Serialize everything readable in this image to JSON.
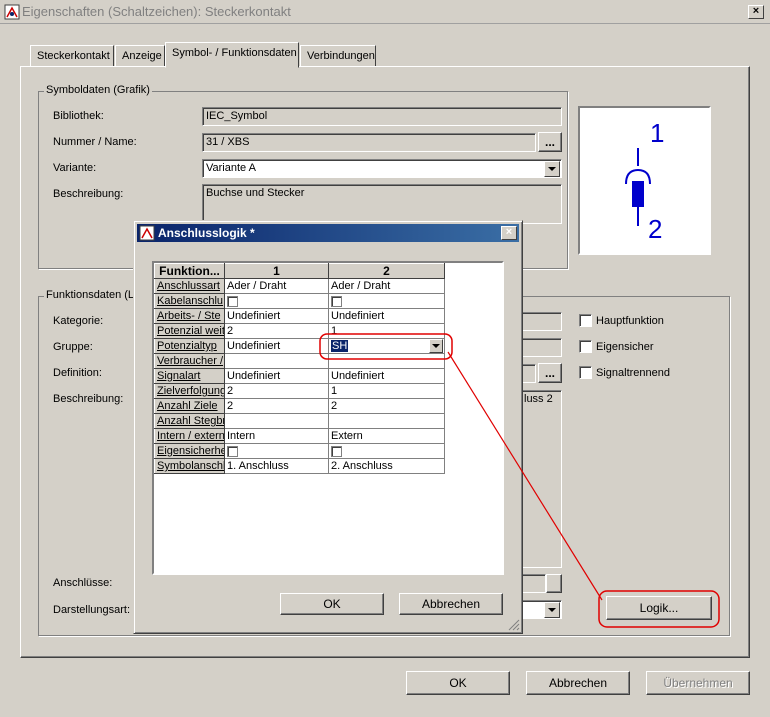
{
  "window": {
    "title": "Eigenschaften (Schaltzeichen): Steckerkontakt",
    "close": "×"
  },
  "tabs": [
    {
      "label": "Steckerkontakt"
    },
    {
      "label": "Anzeige"
    },
    {
      "label": "Symbol- / Funktionsdaten"
    },
    {
      "label": "Verbindungen"
    }
  ],
  "symboldaten": {
    "legend": "Symboldaten (Grafik)",
    "bibliothek_label": "Bibliothek:",
    "bibliothek_value": "IEC_Symbol",
    "nummer_label": "Nummer / Name:",
    "nummer_value": "31 / XBS",
    "variante_label": "Variante:",
    "variante_value": "Variante A",
    "beschreibung_label": "Beschreibung:",
    "beschreibung_value": "Buchse und Stecker",
    "browse": "..."
  },
  "preview": {
    "pin_top": "1",
    "pin_bottom": "2"
  },
  "funktionsdaten": {
    "legend": "Funktionsdaten (L",
    "kategorie_label": "Kategorie:",
    "gruppe_label": "Gruppe:",
    "definition_label": "Definition:",
    "beschreibung_label": "Beschreibung:",
    "beschreibung_partial": "luss 2",
    "anschluesse_label": "Anschlüsse:",
    "darstellungsart_label": "Darstellungsart:",
    "browse": "...",
    "hauptfunktion": "Hauptfunktion",
    "eigensicher": "Eigensicher",
    "signaltrennend": "Signaltrennend",
    "logik_button": "Logik..."
  },
  "footer": {
    "ok": "OK",
    "abbrechen": "Abbrechen",
    "uebernehmen": "Übernehmen"
  },
  "modal": {
    "title": "Anschlusslogik *",
    "close": "×",
    "header": [
      "Funktion...",
      "1",
      "2"
    ],
    "rows": [
      {
        "label": "Anschlussart",
        "c1": "Ader / Draht",
        "c2": "Ader / Draht"
      },
      {
        "label": "Kabelanschlu",
        "c1": "",
        "c2": "",
        "checkbox": true
      },
      {
        "label": "Arbeits- / Ste",
        "c1": "Undefiniert",
        "c2": "Undefiniert"
      },
      {
        "label": "Potenzial weit",
        "c1": "2",
        "c2": "1"
      },
      {
        "label": "Potenzialtyp",
        "c1": "Undefiniert",
        "c2": "SH"
      },
      {
        "label": "Verbraucher /",
        "c1": "",
        "c2": ""
      },
      {
        "label": "Signalart",
        "c1": "Undefiniert",
        "c2": "Undefiniert"
      },
      {
        "label": "Zielverfolgung",
        "c1": "2",
        "c2": "1"
      },
      {
        "label": "Anzahl Ziele",
        "c1": "2",
        "c2": "2"
      },
      {
        "label": "Anzahl Stegbr",
        "c1": "",
        "c2": ""
      },
      {
        "label": "Intern / extern",
        "c1": "Intern",
        "c2": "Extern"
      },
      {
        "label": "Eigensicherhe",
        "c1": "",
        "c2": "",
        "checkbox": true
      },
      {
        "label": "Symbolanschl",
        "c1": "1. Anschluss",
        "c2": "2. Anschluss"
      }
    ],
    "ok": "OK",
    "abbrechen": "Abbrechen"
  },
  "colors": {
    "annotation": "#e00000",
    "title_gradient_start": "#0a246a",
    "title_gradient_end": "#3a6ea5"
  }
}
